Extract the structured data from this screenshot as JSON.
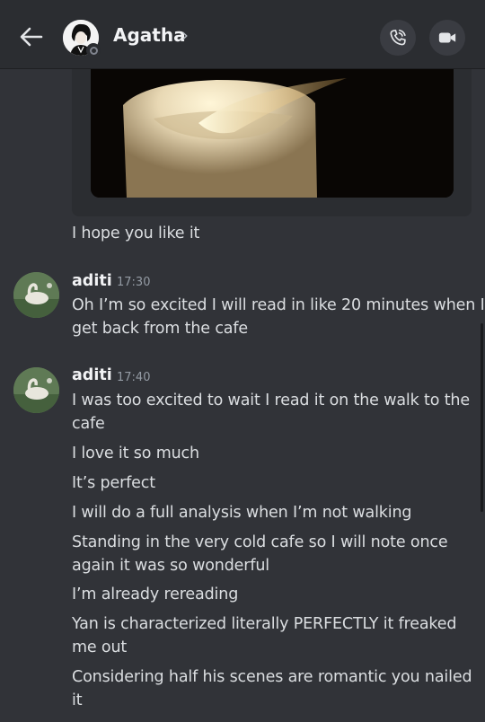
{
  "header": {
    "title": "Agatha",
    "chevron": "›",
    "back_icon": "arrow-left-icon",
    "call_icon": "phone-icon",
    "video_icon": "video-camera-icon"
  },
  "messages": {
    "m0": {
      "lines": [
        "I hope you like it"
      ]
    },
    "m1": {
      "username": "aditi",
      "time": "17:30",
      "lines": [
        "Oh I’m so excited I will read in like 20 minutes when I",
        "get back from the cafe"
      ]
    },
    "m2": {
      "username": "aditi",
      "time": "17:40",
      "lines": [
        "I was too excited to wait I read it on the walk to the",
        "cafe",
        "I love it so much",
        "It’s perfect",
        "I will do a full analysis when I’m not walking",
        "Standing in the very cold cafe so I will note once",
        "again it was so wonderful",
        "I’m already rereading",
        "Yan is characterized literally PERFECTLY it freaked",
        "me out",
        "Considering half his scenes are romantic you nailed",
        "it"
      ]
    }
  },
  "colors": {
    "background": "#313338",
    "header": "#2b2d31",
    "text": "#dbdee1",
    "timestamp": "#949ba4"
  }
}
